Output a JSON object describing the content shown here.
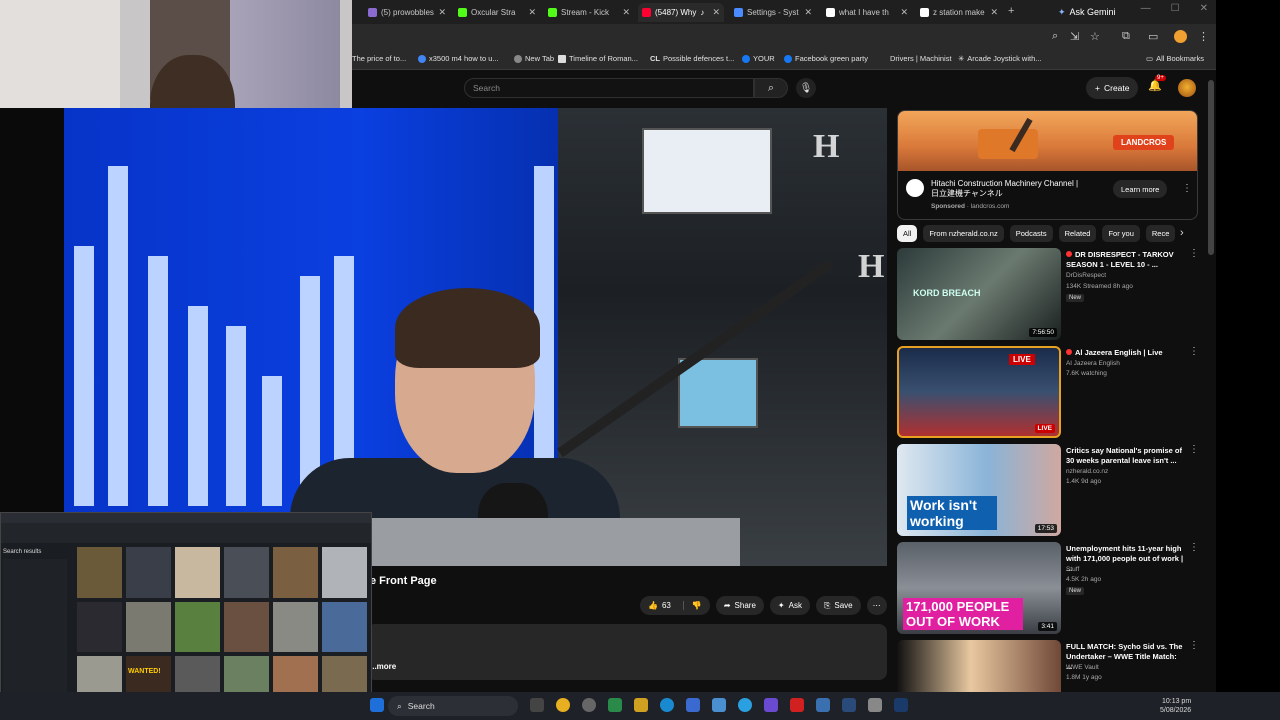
{
  "tabs": [
    {
      "label": "(5) prowobbles",
      "active": false,
      "color": "#8a6bd1"
    },
    {
      "label": "Oxcular Stra",
      "active": false,
      "color": "#53fc18"
    },
    {
      "label": "Stream - Kick",
      "active": false,
      "color": "#53fc18"
    },
    {
      "label": "(5487) Why",
      "active": true,
      "color": "#ff0033"
    },
    {
      "label": "Settings - Syst",
      "active": false,
      "color": "#4a8cff"
    },
    {
      "label": "what I have th",
      "active": false,
      "color": "#ffffff"
    },
    {
      "label": "z station make",
      "active": false,
      "color": "#ffffff"
    }
  ],
  "gemini_label": "Ask Gemini",
  "all_bookmarks_label": "All Bookmarks",
  "bookmarks": [
    "The price of to...",
    "x3500 m4 how to u...",
    "New Tab",
    "Timeline of Roman...",
    "Possible defences t...",
    "YOUR",
    "Facebook green party",
    "Drivers | Machinist",
    "Arcade Joystick with..."
  ],
  "youtube": {
    "search_placeholder": "Search",
    "create_label": "Create",
    "notif_count": "9+"
  },
  "video": {
    "title_visible": "e Front Page",
    "likes": "63",
    "share_label": "Share",
    "ask_label": "Ask",
    "save_label": "Save",
    "more_label": "...more"
  },
  "ad": {
    "brand": "LANDCROS",
    "title": "Hitachi Construction Machinery Channel | 日立建機チャンネル",
    "sponsored": "Sponsored",
    "domain": "landcros.com",
    "cta": "Learn more"
  },
  "chips": [
    "All",
    "From nzherald.co.nz",
    "Podcasts",
    "Related",
    "For you",
    "Rece"
  ],
  "related": [
    {
      "title": "DR DISRESPECT - TARKOV SEASON 1 - LEVEL 10 - ...",
      "channel": "DrDisRespect",
      "meta": "134K  Streamed 8h ago",
      "badge": "New",
      "duration": "7:56:50",
      "thumb_text": "KORD BREACH",
      "live": false
    },
    {
      "title": "Al Jazeera English | Live",
      "channel": "Al Jazeera English",
      "meta": "7.6K watching",
      "badge": "",
      "duration": "LIVE",
      "thumb_text": "",
      "live": true
    },
    {
      "title": "Critics say National's promise of 30 weeks parental leave isn't ...",
      "channel": "nzherald.co.nz",
      "meta": "1.4K  9d ago",
      "badge": "",
      "duration": "17:53",
      "thumb_text": "Work isn't working",
      "live": false
    },
    {
      "title": "Unemployment hits 11-year high with 171,000 people out of work | ...",
      "channel": "Stuff",
      "meta": "4.5K  2h ago",
      "badge": "New",
      "duration": "3:41",
      "thumb_text": "171,000 PEOPLE OUT OF WORK",
      "live": false
    },
    {
      "title": "FULL MATCH: Sycho Sid vs. The Undertaker – WWE Title Match: ...",
      "channel": "WWE Vault",
      "meta": "1.8M  1y ago",
      "badge": "",
      "duration": "",
      "thumb_text": "",
      "live": false
    }
  ],
  "taskbar": {
    "search_label": "Search",
    "time": "10:13 pm",
    "date": "5/08/2026"
  },
  "inset": {
    "search_results_label": "Search results",
    "wanted_label": "WANTED!"
  },
  "colors": {
    "yt_bg": "#0f0f0f",
    "accent_red": "#cc0000",
    "video_blue": "#0a3fe0"
  }
}
